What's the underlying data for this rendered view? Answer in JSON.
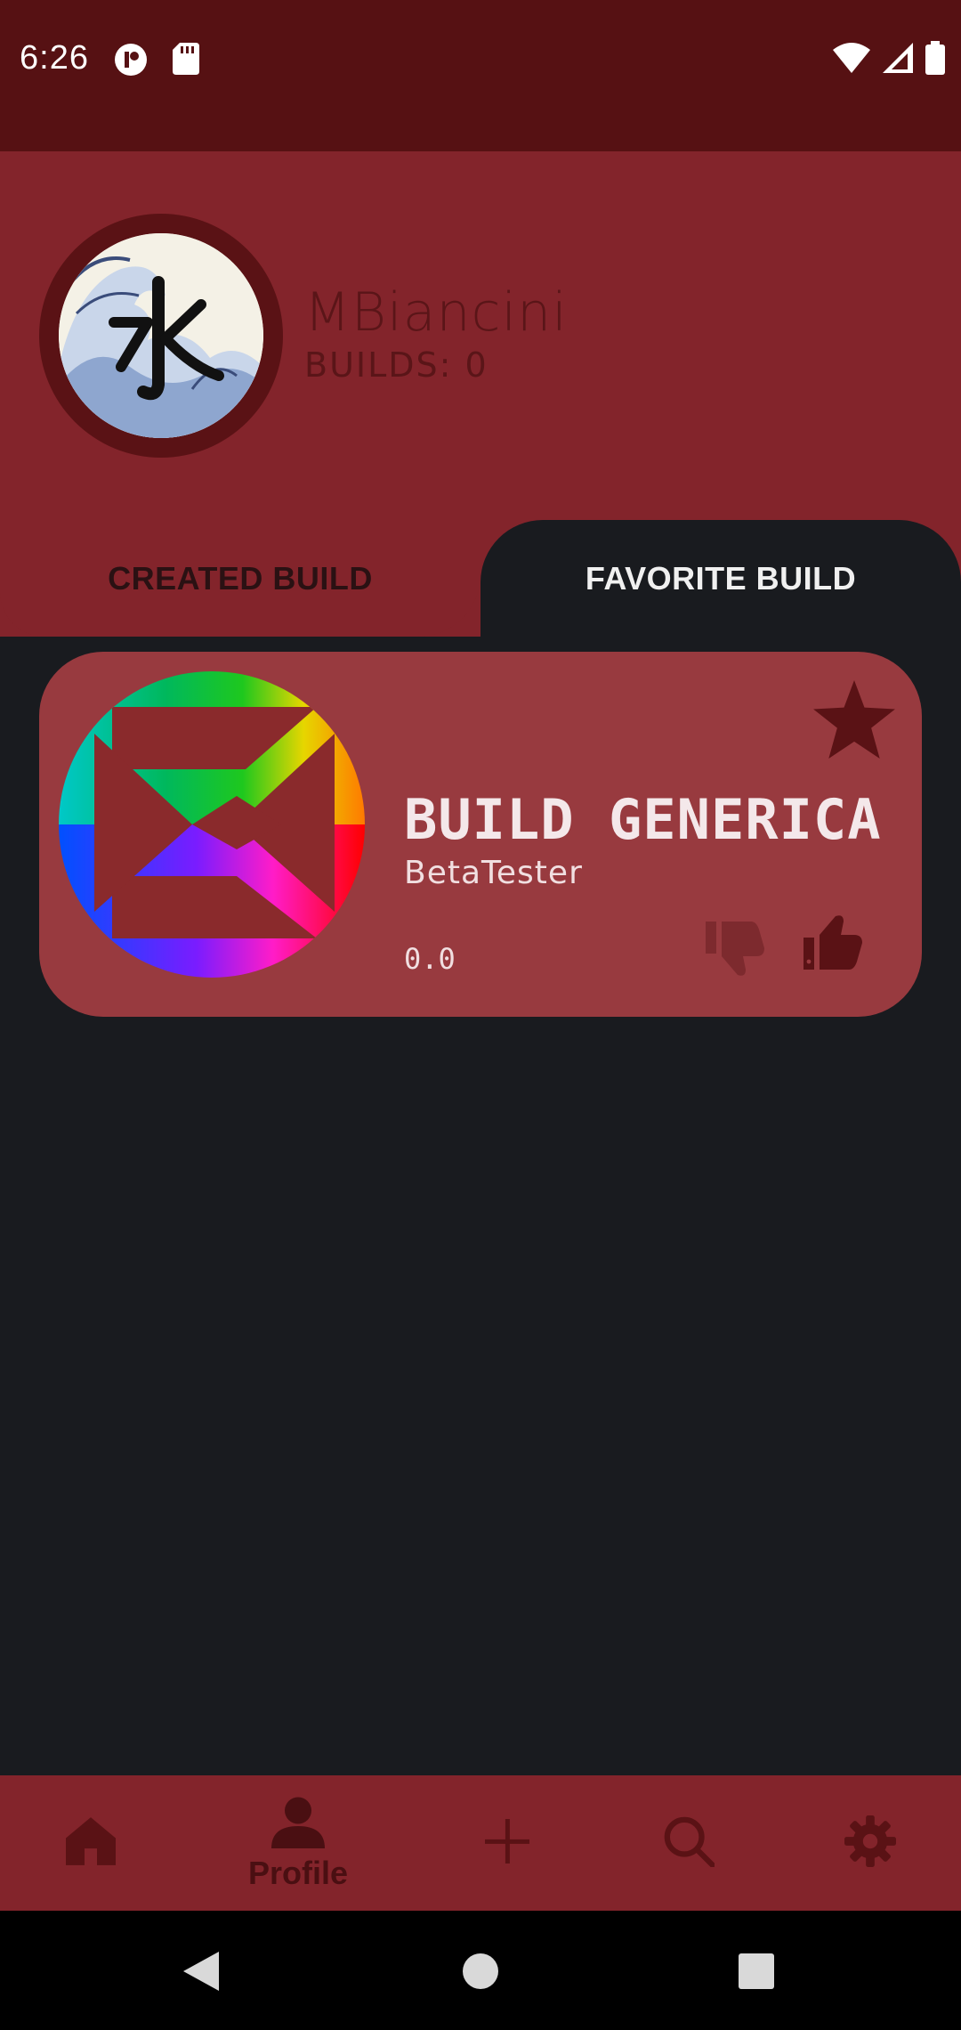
{
  "status_bar": {
    "time": "6:26"
  },
  "profile": {
    "username": "MBiancini",
    "builds_count": "BUILDS: 0"
  },
  "tabs": [
    {
      "label": "CREATED BUILD",
      "selected": false
    },
    {
      "label": "FAVORITE BUILD",
      "selected": true
    }
  ],
  "builds": [
    {
      "title": "BUILD GENERICA",
      "author": "BetaTester",
      "rating": "0.0",
      "favorited": true
    }
  ],
  "bottom_nav": [
    {
      "icon": "home-icon",
      "label": ""
    },
    {
      "icon": "profile-icon",
      "label": "Profile",
      "selected": true
    },
    {
      "icon": "add-icon",
      "label": ""
    },
    {
      "icon": "search-icon",
      "label": ""
    },
    {
      "icon": "settings-icon",
      "label": ""
    }
  ],
  "colors": {
    "status_bar": "#561113",
    "header": "#83242b",
    "card": "#983a3f",
    "background": "#191b1f",
    "accent_dark": "#5a1215"
  }
}
